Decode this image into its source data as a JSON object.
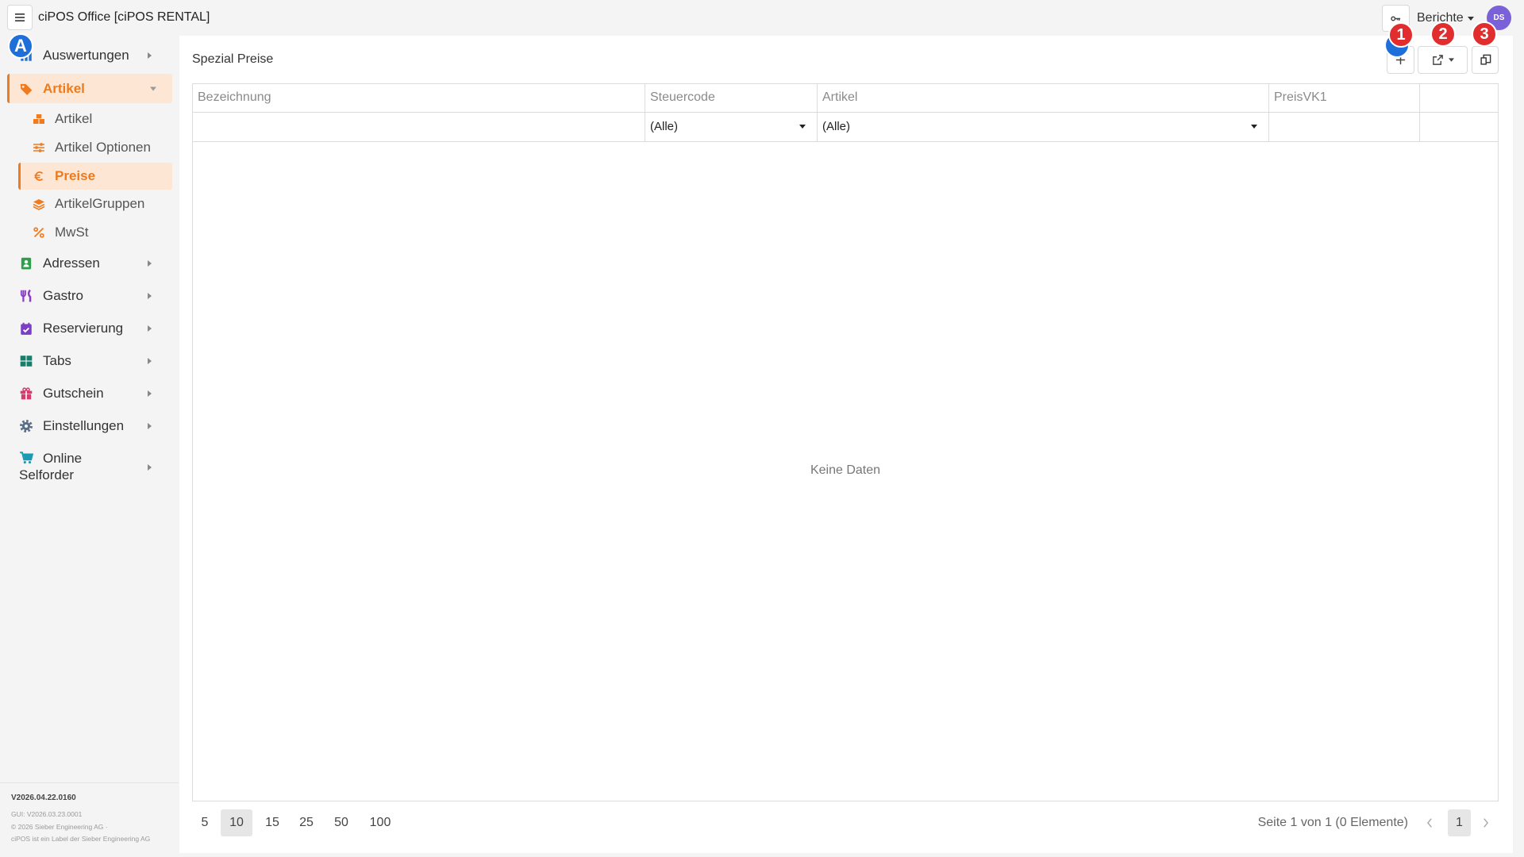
{
  "app": {
    "title": "ciPOS Office [ciPOS RENTAL]"
  },
  "topbar": {
    "menu_icon": "menu-icon",
    "key_icon": "key-icon",
    "reports_label": "Berichte",
    "avatar_initials": "DS"
  },
  "theme": {
    "accent": "#f07b1f",
    "accent_bg": "#fde7d4",
    "avatar": "#7b61d9",
    "annotation_blue": "#1f6fdb",
    "annotation_red": "#e12d2d"
  },
  "annotations": [
    {
      "label": "A",
      "color": "#1f6fdb"
    },
    {
      "color": "#1f6fdb"
    },
    {
      "label": "1",
      "color": "#e12d2d"
    },
    {
      "label": "2",
      "color": "#e12d2d"
    },
    {
      "label": "3",
      "color": "#e12d2d"
    }
  ],
  "sidebar": {
    "items": [
      {
        "label": "Auswertungen",
        "icon": "chart-icon",
        "color": "#2f6fc4",
        "expanded": false
      },
      {
        "label": "Artikel",
        "icon": "tags-icon",
        "color": "#f07b1f",
        "expanded": true,
        "active": true,
        "children": [
          {
            "label": "Artikel",
            "icon": "boxes-icon"
          },
          {
            "label": "Artikel Optionen",
            "icon": "sliders-icon"
          },
          {
            "label": "Preise",
            "icon": "euro-icon",
            "active": true
          },
          {
            "label": "ArtikelGruppen",
            "icon": "layers-icon"
          },
          {
            "label": "MwSt",
            "icon": "percent-icon"
          }
        ]
      },
      {
        "label": "Adressen",
        "icon": "address-book-icon",
        "color": "#2e9e4a",
        "expanded": false
      },
      {
        "label": "Gastro",
        "icon": "utensils-icon",
        "color": "#8a3cc7",
        "expanded": false
      },
      {
        "label": "Reservierung",
        "icon": "calendar-check-icon",
        "color": "#7a3fc4",
        "expanded": false
      },
      {
        "label": "Tabs",
        "icon": "grid-icon",
        "color": "#147f6a",
        "expanded": false
      },
      {
        "label": "Gutschein",
        "icon": "gift-icon",
        "color": "#d83a6e",
        "expanded": false
      },
      {
        "label": "Einstellungen",
        "icon": "gear-icon",
        "color": "#5b6f86",
        "expanded": false
      },
      {
        "label": "Online Selforder",
        "icon": "cart-icon",
        "color": "#1a9bb3",
        "expanded": false
      }
    ],
    "footer": {
      "version": "V2026.04.22.0160",
      "gui_version": "GUI: V2026.03.23.0001",
      "copyright": "© 2026 Sieber Engineering AG ·",
      "label_note": "ciPOS ist ein Label der Sieber Engineering AG"
    }
  },
  "page": {
    "title": "Spezial Preise",
    "toolbar": {
      "add_icon": "plus-icon",
      "export_icon": "export-icon",
      "copy_icon": "copy-icon"
    }
  },
  "grid": {
    "columns": [
      "Bezeichnung",
      "Steuercode",
      "Artikel",
      "PreisVK1",
      ""
    ],
    "filters": {
      "steuercode": "(Alle)",
      "artikel": "(Alle)"
    },
    "empty_text": "Keine Daten"
  },
  "pager": {
    "sizes": [
      "5",
      "10",
      "15",
      "25",
      "50",
      "100"
    ],
    "selected_size": "10",
    "info": "Seite 1 von 1 (0 Elemente)",
    "pages": [
      "1"
    ],
    "current_page": "1"
  }
}
